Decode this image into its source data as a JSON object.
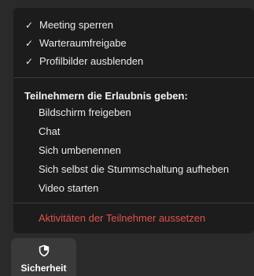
{
  "menu": {
    "toggles": [
      {
        "label": "Meeting sperren",
        "checked": true
      },
      {
        "label": "Warteraumfreigabe",
        "checked": true
      },
      {
        "label": "Profilbilder ausblenden",
        "checked": true
      }
    ],
    "check_glyph": "✓",
    "permissions_heading": "Teilnehmern die Erlaubnis geben:",
    "permissions": [
      {
        "label": "Bildschirm freigeben"
      },
      {
        "label": "Chat"
      },
      {
        "label": "Sich umbenennen"
      },
      {
        "label": "Sich selbst die Stummschaltung aufheben"
      },
      {
        "label": "Video starten"
      }
    ],
    "suspend_label": "Aktivitäten der Teilnehmer aussetzen",
    "colors": {
      "menu_bg": "#1c1c1c",
      "text": "#e9e9e9",
      "danger": "#e2524d"
    }
  },
  "toolbar": {
    "security_label": "Sicherheit",
    "security_icon": "shield-icon"
  }
}
